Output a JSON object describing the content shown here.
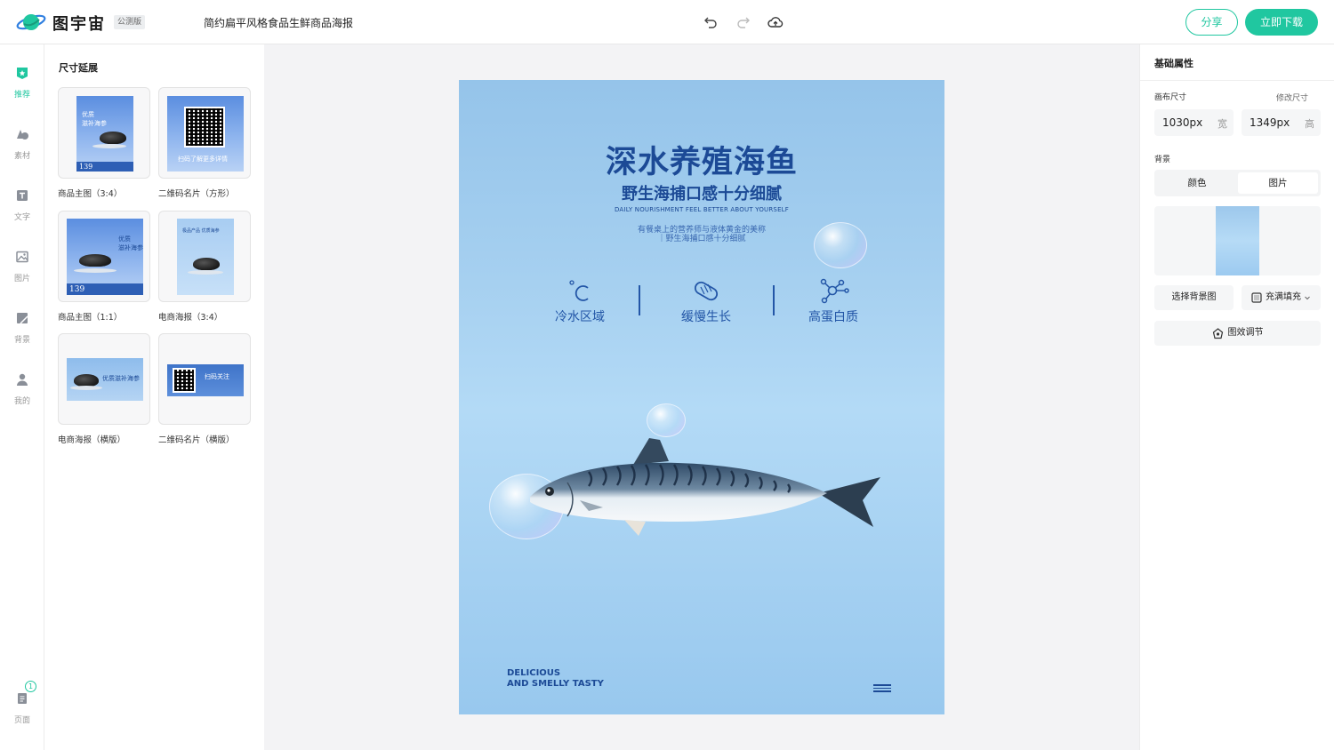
{
  "app": {
    "brand": "图宇宙",
    "badge": "公测版",
    "doc_title": "简约扁平风格食品生鲜商品海报"
  },
  "toolbar": {
    "undo": "undo-icon",
    "redo": "redo-icon",
    "cloud": "cloud-upload-icon",
    "share_label": "分享",
    "download_label": "立即下载"
  },
  "colors": {
    "accent": "#20c7a0",
    "poster_blue": "#1c4a96"
  },
  "leftnav": {
    "items": [
      {
        "label": "推荐",
        "icon": "recommend-icon",
        "active": true
      },
      {
        "label": "素材",
        "icon": "shapes-icon"
      },
      {
        "label": "文字",
        "icon": "text-icon"
      },
      {
        "label": "图片",
        "icon": "image-icon"
      },
      {
        "label": "背景",
        "icon": "background-icon"
      },
      {
        "label": "我的",
        "icon": "user-icon"
      }
    ],
    "pages": {
      "label": "页面",
      "count": "1"
    }
  },
  "panel": {
    "title": "尺寸延展",
    "templates": [
      {
        "caption": "商品主图（3:4）"
      },
      {
        "caption": "二维码名片（方形）"
      },
      {
        "caption": "商品主图（1:1）"
      },
      {
        "caption": "电商海报（3:4）"
      },
      {
        "caption": "电商海报（横版）"
      },
      {
        "caption": "二维码名片（横版）"
      }
    ]
  },
  "poster": {
    "title": "深水养殖海鱼",
    "subtitle": "野生海捕口感十分细腻",
    "english": "DAILY NOURISHMENT FEEL BETTER ABOUT YOURSELF",
    "desc_line1": "有餐桌上的营养师与液体黄金的美称",
    "desc_line2": "｜野生海捕口感十分细腻",
    "features": [
      "冷水区域",
      "缓慢生长",
      "高蛋白质"
    ],
    "footer_line1": "DELICIOUS",
    "footer_line2": "AND SMELLY TASTY"
  },
  "props": {
    "title": "基础属性",
    "canvas_size_label": "画布尺寸",
    "modify_size_label": "修改尺寸",
    "width_value": "1030px",
    "width_unit": "宽",
    "height_value": "1349px",
    "height_unit": "高",
    "background_label": "背景",
    "tab_color": "颜色",
    "tab_image": "图片",
    "select_bg_label": "选择背景图",
    "fill_label": "充满填充",
    "effect_label": "图效调节"
  }
}
